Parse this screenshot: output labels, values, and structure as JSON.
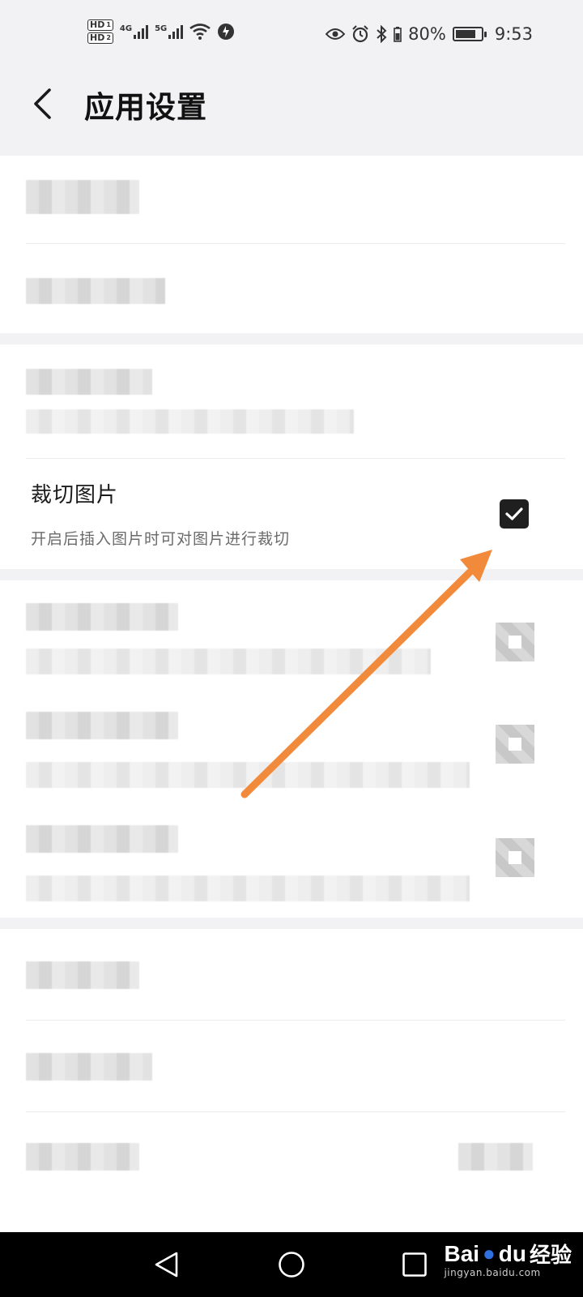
{
  "status_bar": {
    "hd1": "HD",
    "hd1_sub": "1",
    "hd2": "HD",
    "hd2_sub": "2",
    "net1": "4G",
    "net2": "5G",
    "battery_percent": "80%",
    "battery_level": 0.8,
    "time": "9:53",
    "icons": [
      "eye-icon",
      "alarm-icon",
      "bluetooth-icon",
      "battery-icon",
      "wifi-icon",
      "signal-icon"
    ]
  },
  "header": {
    "back_icon": "chevron-left-icon",
    "title": "应用设置"
  },
  "crop_setting": {
    "title": "裁切图片",
    "description": "开启后插入图片时可对图片进行裁切",
    "checked": true
  },
  "bottom_nav": {
    "icons": [
      "back-triangle-icon",
      "home-circle-icon",
      "recents-square-icon"
    ]
  },
  "watermark": {
    "brand_bai": "Bai",
    "brand_du": "du",
    "brand_jy": "经验",
    "url": "jingyan.baidu.com"
  },
  "colors": {
    "accent_arrow": "#f28a3c",
    "checkbox": "#1f1f1f",
    "background": "#f2f2f4"
  }
}
